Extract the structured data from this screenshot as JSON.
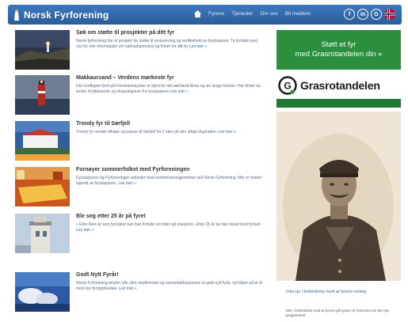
{
  "header": {
    "brand": "Norsk Fyrforening",
    "nav": [
      "Fyrene",
      "Tjenester",
      "Om oss",
      "Bli medlem"
    ],
    "social": [
      "f",
      "in",
      "G"
    ]
  },
  "articles": [
    {
      "title": "Søk om støtte til prosjekter på ditt fyr",
      "excerpt": "Norsk fyrforening har et prosjekt for støtte til restaurering og vedlikehold av fyrstasjoner. Ta kontakt med oss for mer informasjon om søknadsprosess og frister for ditt fyr",
      "more": "Les mer »",
      "thumb": "night-lighthouse"
    },
    {
      "title": "Makkaursand – Verdens mørkeste fyr",
      "excerpt": "Det nordligste fyret på Finnmarkskysten er kjent for sitt værhardt klima og sin lange historie. Her finner du lenker til bildeserier og ekspedisjoner fra fyrstasjonen",
      "more": "Les mer »",
      "thumb": "red-lighthouse"
    },
    {
      "title": "Trondy fyr til Sørfjell",
      "excerpt": "Trondy fyr vender tilbake og pusser til Sørfjell for 2 uker på den årlige dugnaden.",
      "more": "Les mer »",
      "thumb": "white-lighthouse"
    },
    {
      "title": "Fornøyer sommerfolket med Fyrforeningen",
      "excerpt": "Fyrstasjonen og Fyrforeningen arbeider med sommerarrangementer ved Norsk Fyrforening. Mer er hentet opprett av fyrstasjonen.",
      "more": "Les mer »",
      "thumb": "orange-room"
    },
    {
      "title": "Ble seg etter 25 år på fyret",
      "excerpt": "» Etter flere år som fyrvokter kan han fortelle om tiden på stasjonen. Etter 25 år tar han farvel med fyrlivet",
      "more": "Les mer »",
      "thumb": "stone-lighthouse"
    },
    {
      "title": "Godt Nytt Fyrår!",
      "excerpt": "Norsk Fyrforening ønsker alle våre medlemmer og samarbeidspartnere et godt nytt fyrår, og håper på et år med nye fyropplevelser.",
      "more": "Les mer »",
      "thumb": "cloudy-sea"
    }
  ],
  "sidebar": {
    "banner_line1": "Støtt et fyr",
    "banner_line2": "med Grasrotandelen din »",
    "grasrot_brand": "Grasrotandelen",
    "caption": "Intervju i forbindelse med at fyrene moteg",
    "caption_sub": "Mer i forbindelse med at fyrene på kysten er informert om det nye programmet."
  },
  "colors": {
    "header": "#2f68ad",
    "banner": "#2c8f3d",
    "title": "#333333",
    "link": "#2c5f9e"
  }
}
